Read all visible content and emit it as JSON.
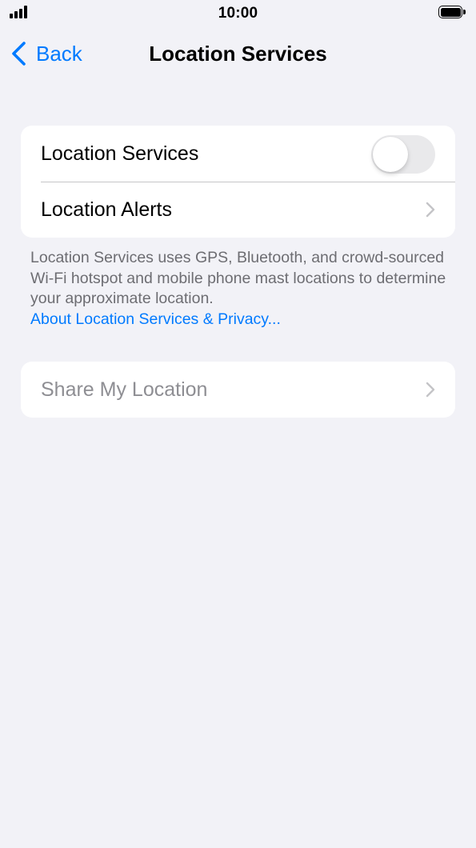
{
  "status_bar": {
    "time": "10:00",
    "signal_icon": "cellular-signal-icon",
    "battery_icon": "battery-full-icon"
  },
  "nav": {
    "back_label": "Back",
    "back_icon": "chevron-left-icon",
    "title": "Location Services"
  },
  "settings_group": {
    "location_services": {
      "label": "Location Services",
      "toggle_on": false
    },
    "location_alerts": {
      "label": "Location Alerts",
      "icon": "chevron-right-icon"
    }
  },
  "footer": {
    "description": "Location Services uses GPS, Bluetooth, and crowd-sourced Wi-Fi hotspot and mobile phone mast locations to determine your approximate location.",
    "link": "About Location Services & Privacy..."
  },
  "share_group": {
    "share_my_location": {
      "label": "Share My Location",
      "disabled": true,
      "icon": "chevron-right-icon"
    }
  },
  "colors": {
    "background": "#f2f2f7",
    "accent": "#007aff",
    "secondary_text": "#6d6d72",
    "disabled_text": "#8e8e93",
    "toggle_off": "#e9e9eb"
  }
}
